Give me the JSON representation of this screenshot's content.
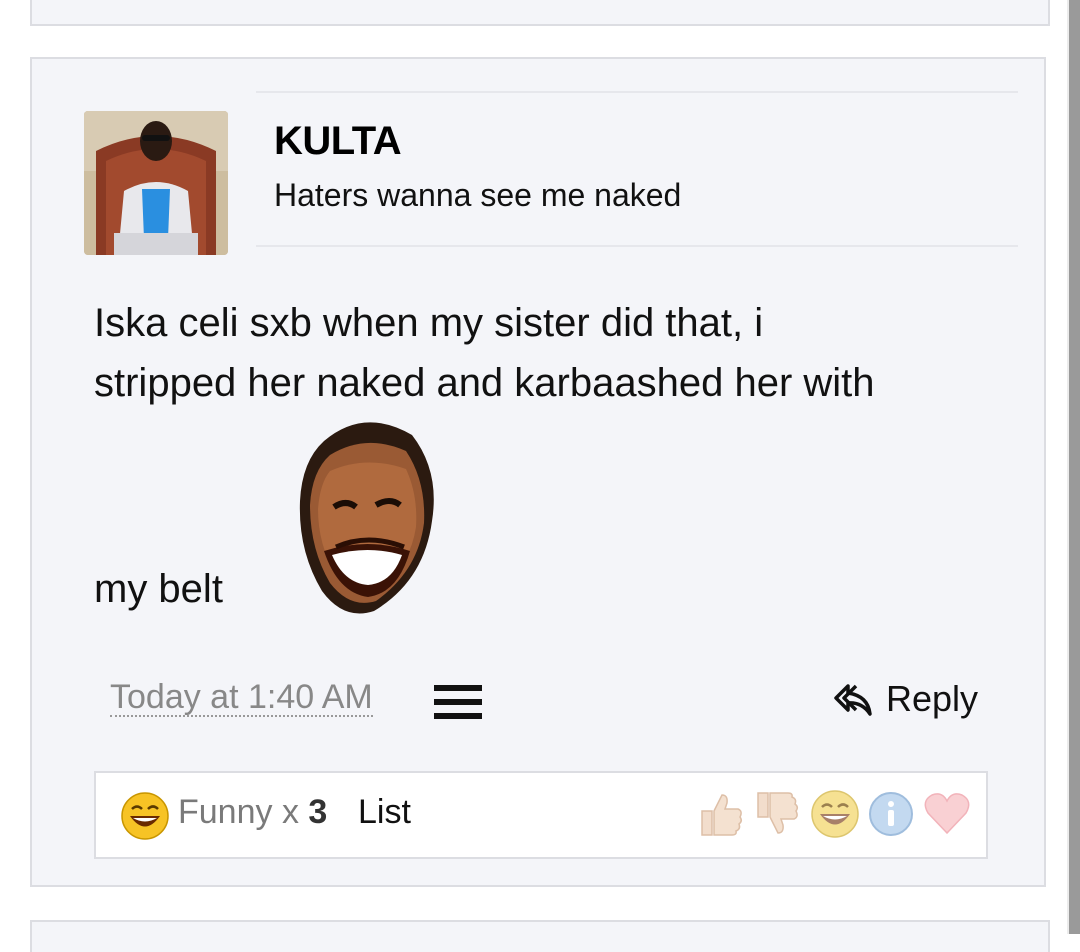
{
  "post": {
    "username": "KULTA",
    "user_title": "Haters wanna see me naked",
    "message_lines": [
      "Iska celi sxb when my sister did that, i",
      "stripped her naked and karbaashed her with"
    ],
    "message_tail": "my belt",
    "smilie_icon": "laughing-face-smilie-icon",
    "timestamp": "Today at 1:40 AM",
    "reply_label": "Reply"
  },
  "reactions": {
    "summary_icon": "laughing-emoji-icon",
    "summary_label": "Funny x ",
    "summary_count": "3",
    "list_label": "List",
    "rating_icons": [
      "thumbs-up-icon",
      "thumbs-down-icon",
      "funny-icon",
      "info-icon",
      "heart-icon"
    ]
  },
  "colors": {
    "post_background": "#f4f5f9",
    "border": "#dcdde2",
    "muted_text": "#888888"
  }
}
